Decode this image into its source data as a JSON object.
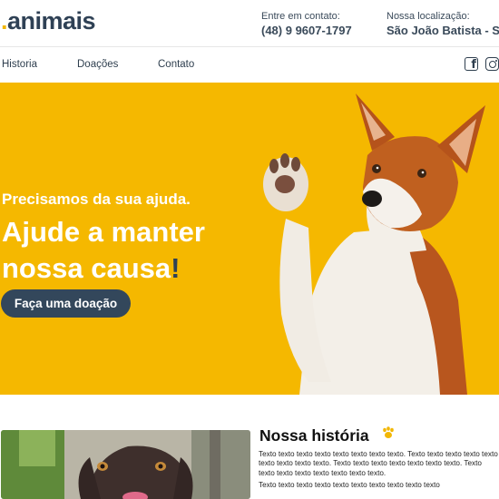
{
  "header": {
    "logo_dot": ".",
    "logo_text": "animais",
    "contact_label": "Entre em contato:",
    "contact_phone": "(48) 9 9607-1797",
    "location_label": "Nossa localização:",
    "location_value": "São João Batista - SC"
  },
  "nav": {
    "items": [
      {
        "label": "Historia"
      },
      {
        "label": "Doações"
      },
      {
        "label": "Contato"
      }
    ],
    "social": [
      "facebook-icon",
      "instagram-icon"
    ]
  },
  "hero": {
    "eyebrow": "Precisamos da sua ajuda.",
    "title": "Ajude a manter nossa causa",
    "title_bang": "!",
    "cta_label": "Faça uma doação",
    "background": "#f5b800"
  },
  "history": {
    "title": "Nossa história",
    "icon": "paw-icon",
    "paragraph_1": "Texto texto texto texto texto texto texto texto. Texto texto texto texto texto texto texto texto texto. Texto texto texto texto texto texto texto. Texto texto texto texto texto texto texto texto.",
    "paragraph_2": "Texto texto texto texto texto texto texto texto texto texto"
  },
  "colors": {
    "accent": "#f5b800",
    "navy": "#2f4155",
    "button": "#33475b"
  }
}
